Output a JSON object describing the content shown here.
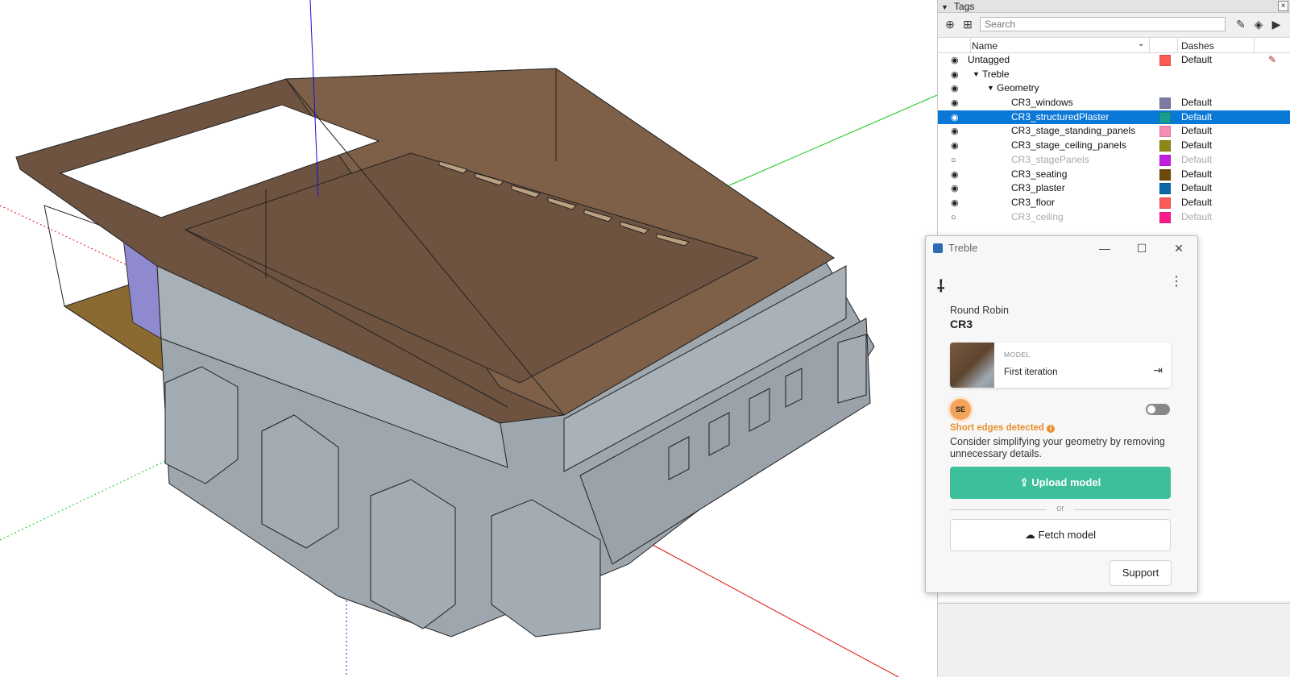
{
  "tags": {
    "title": "Tags",
    "search_placeholder": "Search",
    "columns": {
      "name": "Name",
      "dashes": "Dashes"
    },
    "rows": [
      {
        "name": "Untagged",
        "indent": 0,
        "visible": true,
        "color": "#ff5a52",
        "dashes": "Default",
        "caret": ""
      },
      {
        "name": "Treble",
        "indent": 1,
        "visible": true,
        "color": "",
        "dashes": "",
        "caret": "▼"
      },
      {
        "name": "Geometry",
        "indent": 2,
        "visible": true,
        "color": "",
        "dashes": "",
        "caret": "▼"
      },
      {
        "name": "CR3_windows",
        "indent": 3,
        "visible": true,
        "color": "#7a7aa5",
        "dashes": "Default",
        "caret": ""
      },
      {
        "name": "CR3_structuredPlaster",
        "indent": 3,
        "visible": true,
        "color": "#1a9e8c",
        "dashes": "Default",
        "caret": "",
        "selected": true
      },
      {
        "name": "CR3_stage_standing_panels",
        "indent": 3,
        "visible": true,
        "color": "#f78db5",
        "dashes": "Default",
        "caret": ""
      },
      {
        "name": "CR3_stage_ceiling_panels",
        "indent": 3,
        "visible": true,
        "color": "#8c8a14",
        "dashes": "Default",
        "caret": ""
      },
      {
        "name": "CR3_stagePanels",
        "indent": 3,
        "visible": false,
        "color": "#c21fe0",
        "dashes": "Default",
        "caret": ""
      },
      {
        "name": "CR3_seating",
        "indent": 3,
        "visible": true,
        "color": "#6e4a0a",
        "dashes": "Default",
        "caret": ""
      },
      {
        "name": "CR3_plaster",
        "indent": 3,
        "visible": true,
        "color": "#0a6aa8",
        "dashes": "Default",
        "caret": ""
      },
      {
        "name": "CR3_floor",
        "indent": 3,
        "visible": true,
        "color": "#ff5a5a",
        "dashes": "Default",
        "caret": ""
      },
      {
        "name": "CR3_ceiling",
        "indent": 3,
        "visible": false,
        "color": "#ff1a8c",
        "dashes": "Default",
        "caret": ""
      }
    ]
  },
  "treble": {
    "window_title": "Treble",
    "project": "Round Robin",
    "model_name": "CR3",
    "card_label": "MODEL",
    "iteration": "First iteration",
    "avatar": "SE",
    "warning": "Short edges detected",
    "description": "Consider simplifying your geometry by removing unnecessary details.",
    "upload_label": "Upload model",
    "or_label": "or",
    "fetch_label": "Fetch model",
    "support_label": "Support",
    "accent": "#3cbf9a"
  }
}
